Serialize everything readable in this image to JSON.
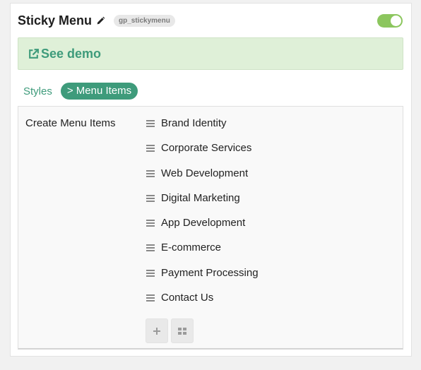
{
  "widget": {
    "title": "Sticky Menu",
    "slug": "gp_stickymenu",
    "enabled": true
  },
  "demo": {
    "label": "See demo",
    "icon": "external-link-icon"
  },
  "tabs": {
    "styles_label": "Styles",
    "active_label": "> Menu Items"
  },
  "panel": {
    "label": "Create Menu Items",
    "items": [
      {
        "label": "Brand Identity"
      },
      {
        "label": "Corporate Services"
      },
      {
        "label": "Web Development"
      },
      {
        "label": "Digital Marketing"
      },
      {
        "label": "App Development"
      },
      {
        "label": "E-commerce"
      },
      {
        "label": "Payment Processing"
      },
      {
        "label": "Contact Us"
      }
    ],
    "actions": [
      {
        "name": "add-item-button",
        "icon": "plus-icon"
      },
      {
        "name": "grid-view-button",
        "icon": "grid-icon"
      }
    ]
  },
  "colors": {
    "accent": "#3e9b7b",
    "toggle_on": "#8cc65e",
    "demo_bg": "#dff0d8"
  }
}
